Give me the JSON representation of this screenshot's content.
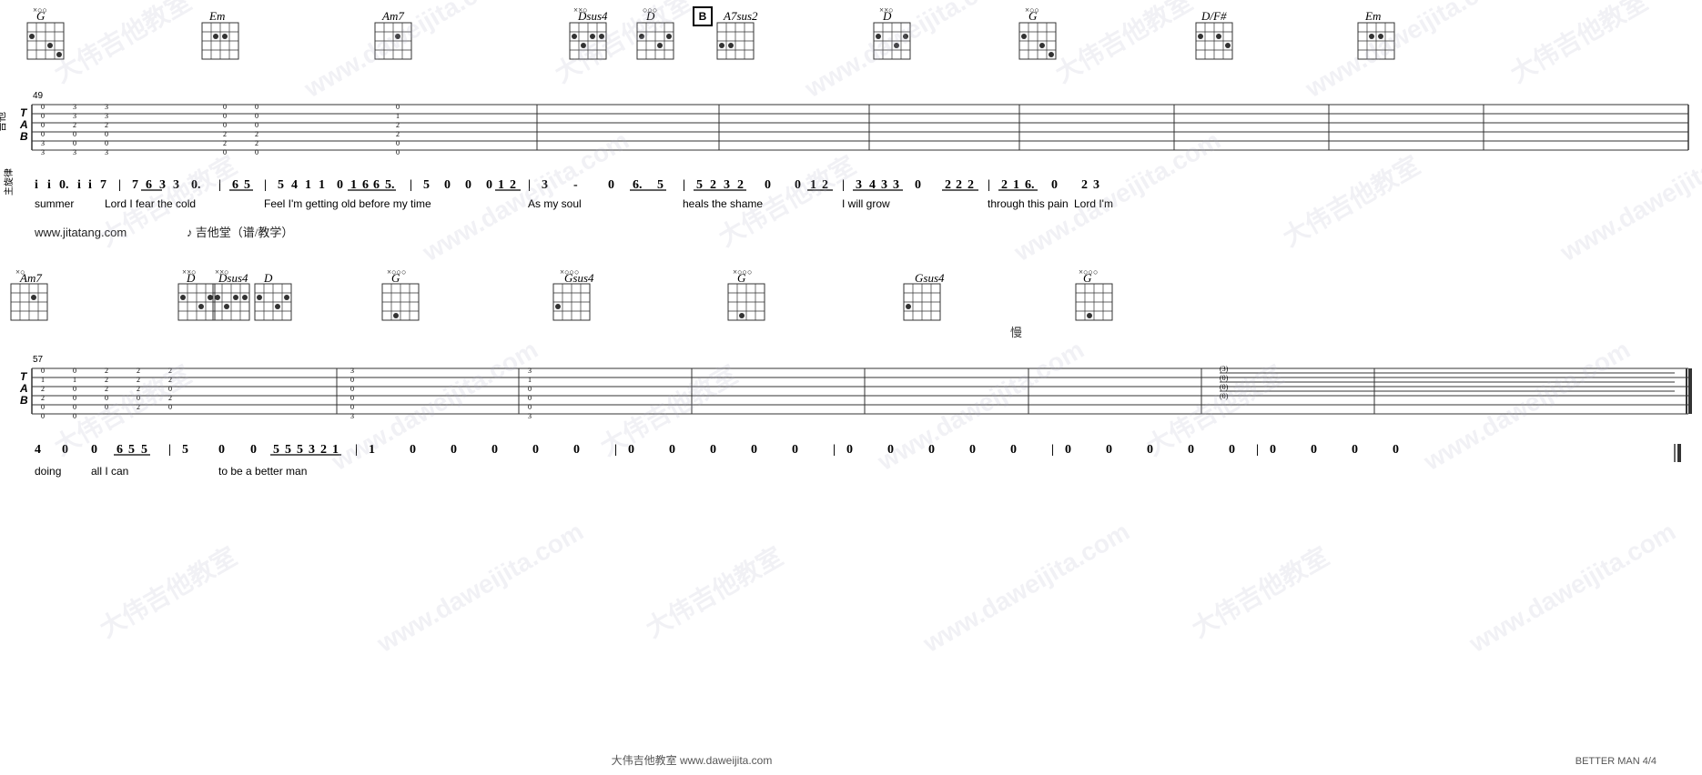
{
  "page": {
    "title": "BETTER MAN",
    "page_number": "4/4",
    "footer_website": "大伟吉他教室 www.daweijita.com",
    "footer_title": "BETTER MAN  4/4"
  },
  "watermarks": [
    "大伟吉他教室",
    "www.daweijita.com",
    "大伟吉他教室",
    "www.daweijita.com"
  ],
  "section1": {
    "measure_start": 49,
    "chord_names": [
      "G",
      "Em",
      "Am7",
      "",
      "Dsus4",
      "D",
      "A7sus2",
      "D",
      "G",
      "D/F#",
      "Em"
    ],
    "notation": "i i 0. i i 7 | 7 6 3 3  0. | 6 5 | 5 4 1 1  0 1 6 6 5. | 5  0  0  0 1 2 | 3  -  0  6. 5 | 5 2 3 2  0  0 1 2 | 3 4 3 3  0  2 2 2 | 2 1 6.  0  2 3",
    "lyrics": "summer    Lord I fear the cold         Feel I'm getting old before my time              As my soul         heals the shame         I will grow         through this pain    Lord I'm"
  },
  "website_line": {
    "url": "www.jitatang.com",
    "icon": "guitar-icon",
    "text": "吉他堂（谱/教学）"
  },
  "section2": {
    "measure_start": 57,
    "chord_names": [
      "Am7",
      "D",
      "Dsus4",
      "D",
      "G",
      "Gsus4",
      "G",
      "Gsus4",
      "G"
    ],
    "notation": "4  0  0  6 5 5  |  5  0  0 5 5 5 3 2 1 | 1  0  0  0  0  0  | 0  0  0  0  0  0 | 0  0  0  0  0  0 | 0  0  0  0  0  0 | 0  0  0  0",
    "lyrics": "doing    all I can              to  be a better man"
  },
  "section1_tab_label": "吉他",
  "section2_notation_label": "主旋律",
  "b_marker": "B"
}
